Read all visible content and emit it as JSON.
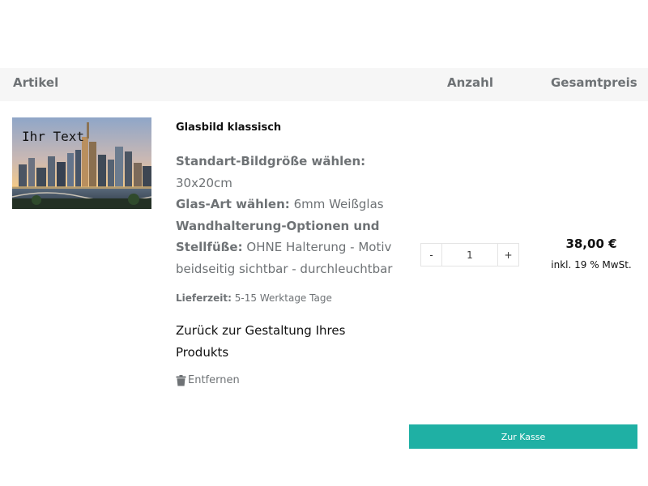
{
  "table_header": {
    "article": "Artikel",
    "quantity": "Anzahl",
    "total_price": "Gesamtpreis"
  },
  "item": {
    "image_text": "Ihr Text",
    "title": "Glasbild klassisch",
    "options": [
      {
        "label": "Standart-Bildgröße wählen:",
        "value": "30x20cm"
      },
      {
        "label": "Glas-Art wählen:",
        "value": "6mm Weißglas"
      },
      {
        "label": "Wandhalterung-Optionen und Stellfüße:",
        "value": "OHNE Halterung - Motiv beidseitig sichtbar - durchleuchtbar"
      }
    ],
    "delivery_label": "Lieferzeit:",
    "delivery_value": "5-15 Werktage Tage",
    "back_link": "Zurück zur Gestaltung Ihres Produkts",
    "remove_label": "Entfernen",
    "remove_icon": "trash-icon",
    "quantity": {
      "minus": "-",
      "value": "1",
      "plus": "+"
    },
    "price": "38,00 €",
    "vat_note": "inkl. 19 % MwSt."
  },
  "checkout": {
    "label": "Zur Kasse"
  },
  "colors": {
    "accent": "#1fb0a4",
    "header_bg": "#f6f6f6",
    "muted_text": "#6e7275"
  }
}
